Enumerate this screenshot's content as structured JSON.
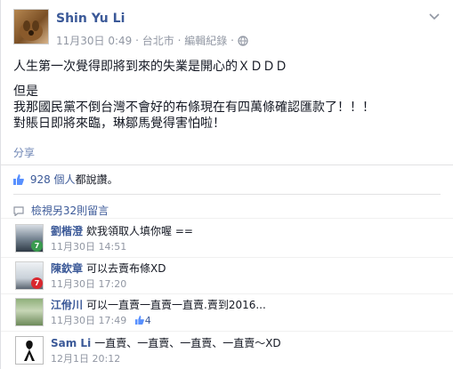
{
  "post": {
    "author": "Shin Yu Li",
    "date": "11月30日 0:49",
    "dot1": "·",
    "location": "台北市",
    "dot2": "·",
    "edit_history": "編輯紀錄",
    "dot3": "·",
    "lines": [
      "人生第一次覺得即將到來的失業是開心的ＸＤＤＤ",
      "但是",
      "我那國民黨不倒台灣不會好的布條現在有四萬條確認匯款了！！！",
      "對賬日即將來臨，琳鄒馬覺得害怕啦！"
    ],
    "share_label": "分享"
  },
  "likes": {
    "text_count": "928 個人",
    "text_rest": "都說讚。"
  },
  "view_more": "檢視另32則留言",
  "comments": [
    {
      "name": "劉楷澄",
      "text": "欸我領取人填你喔 ==",
      "time": "11月30日 14:51",
      "badge": "7",
      "badge_color": "#3a9b4f"
    },
    {
      "name": "陳欽章",
      "text": "可以去賣布條XD",
      "time": "11月30日 17:20",
      "badge": "7",
      "badge_color": "#d9272e"
    },
    {
      "name": "江佾川",
      "text": "可以一直賣一直賣一直賣.賣到2016...",
      "time": "11月30日 17:49",
      "likes": "4"
    },
    {
      "name": "Sam Li",
      "text": "一直賣、一直賣、一直賣、一直賣～XD",
      "time": "12月1日 20:12"
    }
  ],
  "colors": {
    "link": "#3b5998",
    "meta": "#9197a3",
    "text": "#141823"
  }
}
